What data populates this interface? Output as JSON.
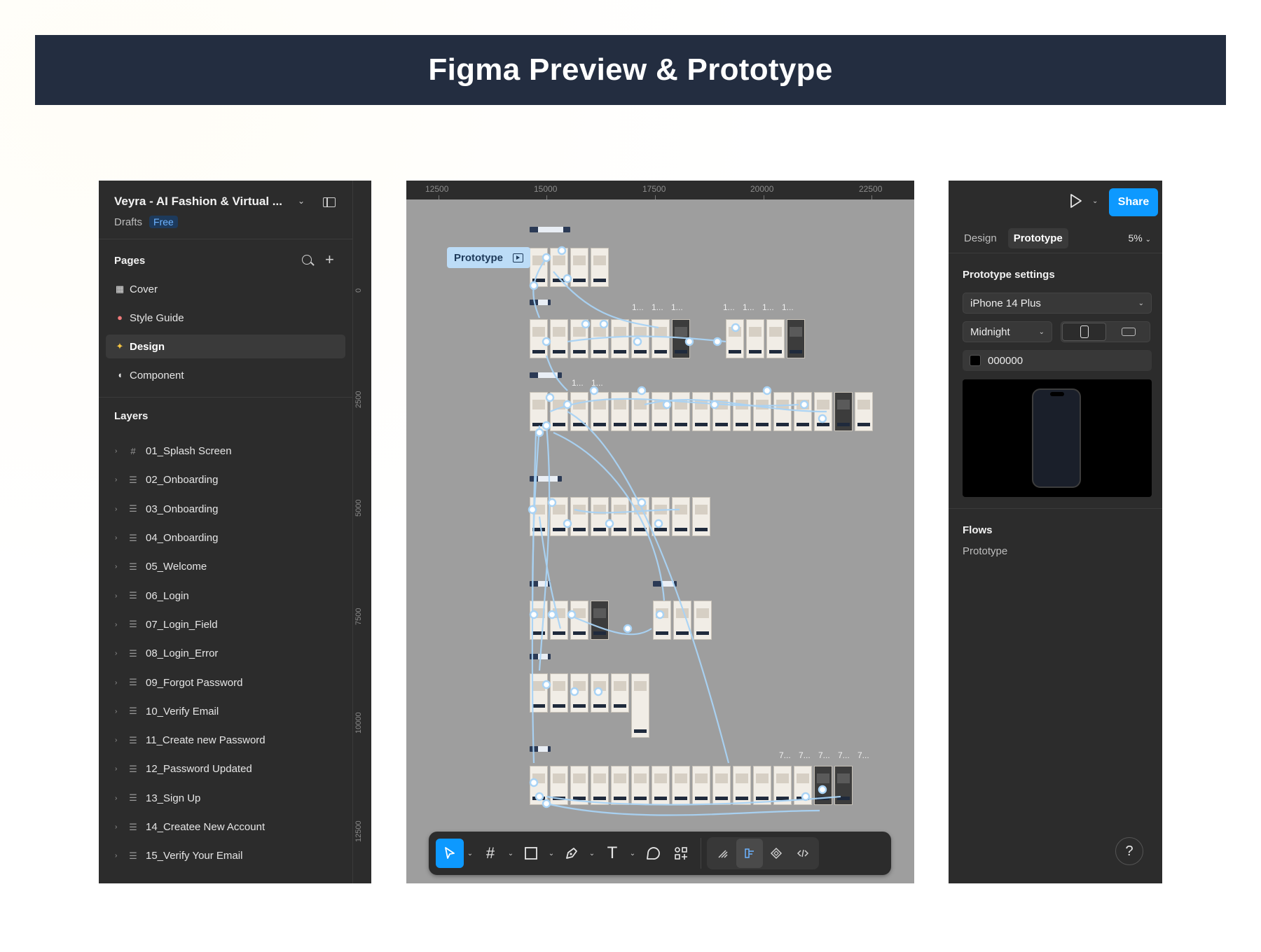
{
  "banner": {
    "title": "Figma Preview & Prototype"
  },
  "left_panel": {
    "file_title": "Veyra - AI Fashion & Virtual ...",
    "location": "Drafts",
    "plan": "Free",
    "pages_label": "Pages",
    "pages": [
      {
        "label": "Cover",
        "icon": "cover-emoji"
      },
      {
        "label": "Style Guide",
        "icon": "palette-emoji"
      },
      {
        "label": "Design",
        "icon": "sparkles-emoji",
        "active": true
      },
      {
        "label": "Component",
        "icon": "speech-bubble-emoji"
      }
    ],
    "layers_label": "Layers",
    "layers": [
      "01_Splash Screen",
      "02_Onboarding",
      "03_Onboarding",
      "04_Onboarding",
      "05_Welcome",
      "06_Login",
      "07_Login_Field",
      "08_Login_Error",
      "09_Forgot Password",
      "10_Verify Email",
      "11_Create new Password",
      "12_Password Updated",
      "13_Sign Up",
      "14_Createe New Account",
      "15_Verify Your Email"
    ],
    "ruler_ticks": [
      "0",
      "2500",
      "5000",
      "7500",
      "10000",
      "12500"
    ]
  },
  "canvas": {
    "ruler_ticks": [
      "12500",
      "15000",
      "17500",
      "20000",
      "22500"
    ],
    "flow_chip_label": "Prototype",
    "frame_labels": [
      "1...",
      "1...",
      "1...",
      "1...",
      "1...",
      "1...",
      "1...",
      "1...",
      "1...",
      "7...",
      "7...",
      "7...",
      "7...",
      "7..."
    ]
  },
  "right_panel": {
    "share_label": "Share",
    "tabs": [
      "Design",
      "Prototype"
    ],
    "active_tab": "Prototype",
    "zoom": "5%",
    "settings_title": "Prototype settings",
    "device": "iPhone 14 Plus",
    "model_color": "Midnight",
    "background_color": "000000",
    "flows_title": "Flows",
    "flows": [
      "Prototype"
    ],
    "help_label": "?"
  }
}
